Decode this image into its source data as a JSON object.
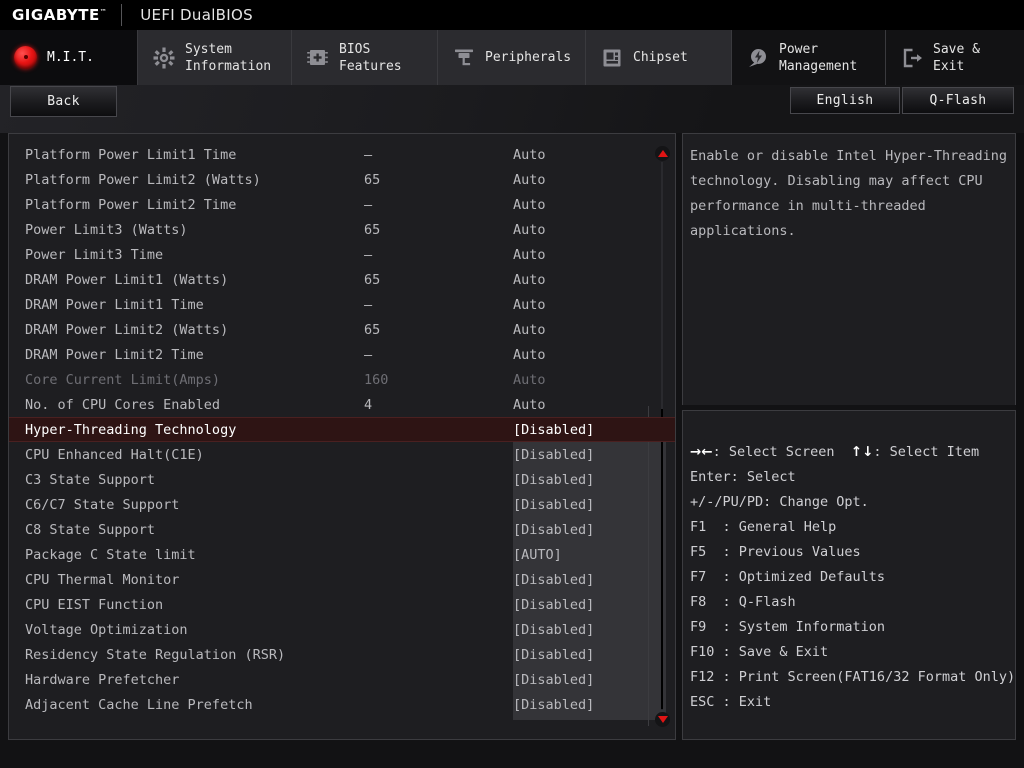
{
  "brand": {
    "logo": "GIGABYTE",
    "trademark": "™",
    "subtitle": "UEFI DualBIOS"
  },
  "nav": {
    "tabs": [
      {
        "label": "M.I.T.",
        "icon": "red-dot-icon",
        "active": true
      },
      {
        "label": "System\nInformation",
        "icon": "gear-icon",
        "active": false
      },
      {
        "label": "BIOS\nFeatures",
        "icon": "chip-plus-icon",
        "active": false
      },
      {
        "label": "Peripherals",
        "icon": "plug-icon",
        "active": false
      },
      {
        "label": "Chipset",
        "icon": "chipset-icon",
        "active": false
      },
      {
        "label": "Power\nManagement",
        "icon": "power-bolt-icon",
        "active": false
      },
      {
        "label": "Save & Exit",
        "icon": "exit-door-icon",
        "active": false
      }
    ]
  },
  "toolbar": {
    "back_label": "Back",
    "language_label": "English",
    "qflash_label": "Q-Flash"
  },
  "settings": {
    "rows": [
      {
        "name": "Platform Power Limit1 Time",
        "num": "–",
        "value": "Auto",
        "dim": false,
        "selected": false
      },
      {
        "name": "Platform Power Limit2 (Watts)",
        "num": "65",
        "value": "Auto",
        "dim": false,
        "selected": false
      },
      {
        "name": "Platform Power Limit2 Time",
        "num": "–",
        "value": "Auto",
        "dim": false,
        "selected": false
      },
      {
        "name": "Power Limit3 (Watts)",
        "num": "65",
        "value": "Auto",
        "dim": false,
        "selected": false
      },
      {
        "name": "Power Limit3 Time",
        "num": "–",
        "value": "Auto",
        "dim": false,
        "selected": false
      },
      {
        "name": "DRAM Power Limit1 (Watts)",
        "num": "65",
        "value": "Auto",
        "dim": false,
        "selected": false
      },
      {
        "name": "DRAM Power Limit1 Time",
        "num": "–",
        "value": "Auto",
        "dim": false,
        "selected": false
      },
      {
        "name": "DRAM Power Limit2 (Watts)",
        "num": "65",
        "value": "Auto",
        "dim": false,
        "selected": false
      },
      {
        "name": "DRAM Power Limit2 Time",
        "num": "–",
        "value": "Auto",
        "dim": false,
        "selected": false
      },
      {
        "name": "Core Current Limit(Amps)",
        "num": "160",
        "value": "Auto",
        "dim": true,
        "selected": false
      },
      {
        "name": "No. of CPU Cores Enabled",
        "num": "4",
        "value": "Auto",
        "dim": false,
        "selected": false
      },
      {
        "name": "Hyper-Threading Technology",
        "num": "",
        "value": "[Disabled]",
        "dim": false,
        "selected": true
      },
      {
        "name": "CPU Enhanced Halt(C1E)",
        "num": "",
        "value": "[Disabled]",
        "dim": false,
        "selected": false
      },
      {
        "name": "C3 State Support",
        "num": "",
        "value": "[Disabled]",
        "dim": false,
        "selected": false
      },
      {
        "name": "C6/C7 State Support",
        "num": "",
        "value": "[Disabled]",
        "dim": false,
        "selected": false
      },
      {
        "name": "C8 State Support",
        "num": "",
        "value": "[Disabled]",
        "dim": false,
        "selected": false
      },
      {
        "name": "Package C State limit",
        "num": "",
        "value": "[AUTO]",
        "dim": false,
        "selected": false
      },
      {
        "name": "CPU Thermal Monitor",
        "num": "",
        "value": "[Disabled]",
        "dim": false,
        "selected": false
      },
      {
        "name": "CPU EIST Function",
        "num": "",
        "value": "[Disabled]",
        "dim": false,
        "selected": false
      },
      {
        "name": "Voltage Optimization",
        "num": "",
        "value": "[Disabled]",
        "dim": false,
        "selected": false
      },
      {
        "name": "Residency State Regulation (RSR)",
        "num": "",
        "value": "[Disabled]",
        "dim": false,
        "selected": false
      },
      {
        "name": "Hardware Prefetcher",
        "num": "",
        "value": "[Disabled]",
        "dim": false,
        "selected": false
      },
      {
        "name": "Adjacent Cache Line Prefetch",
        "num": "",
        "value": "[Disabled]",
        "dim": false,
        "selected": false
      }
    ]
  },
  "help": {
    "lines": [
      "Enable or disable Intel Hyper-Threading",
      "technology. Disabling may affect CPU",
      "performance in multi-threaded",
      "applications."
    ]
  },
  "keys": {
    "lines": [
      {
        "glyph": "→←",
        "text": ": Select Screen  ",
        "glyph2": "↑↓",
        "text2": ": Select Item"
      },
      {
        "glyph": "",
        "text": "Enter: Select",
        "glyph2": "",
        "text2": ""
      },
      {
        "glyph": "",
        "text": "+/-/PU/PD: Change Opt.",
        "glyph2": "",
        "text2": ""
      },
      {
        "glyph": "",
        "text": "F1  : General Help",
        "glyph2": "",
        "text2": ""
      },
      {
        "glyph": "",
        "text": "F5  : Previous Values",
        "glyph2": "",
        "text2": ""
      },
      {
        "glyph": "",
        "text": "F7  : Optimized Defaults",
        "glyph2": "",
        "text2": ""
      },
      {
        "glyph": "",
        "text": "F8  : Q-Flash",
        "glyph2": "",
        "text2": ""
      },
      {
        "glyph": "",
        "text": "F9  : System Information",
        "glyph2": "",
        "text2": ""
      },
      {
        "glyph": "",
        "text": "F10 : Save & Exit",
        "glyph2": "",
        "text2": ""
      },
      {
        "glyph": "",
        "text": "F12 : Print Screen(FAT16/32 Format Only)",
        "glyph2": "",
        "text2": ""
      },
      {
        "glyph": "",
        "text": "ESC : Exit",
        "glyph2": "",
        "text2": ""
      }
    ]
  },
  "scroll": {
    "up_arrow": "scroll-up-arrow",
    "down_arrow": "scroll-down-arrow"
  },
  "colors": {
    "accent_red": "#e01414",
    "selected_row_bg": "#2e1414",
    "panel_bg": "#1e1e21",
    "border": "#3c3c40"
  }
}
